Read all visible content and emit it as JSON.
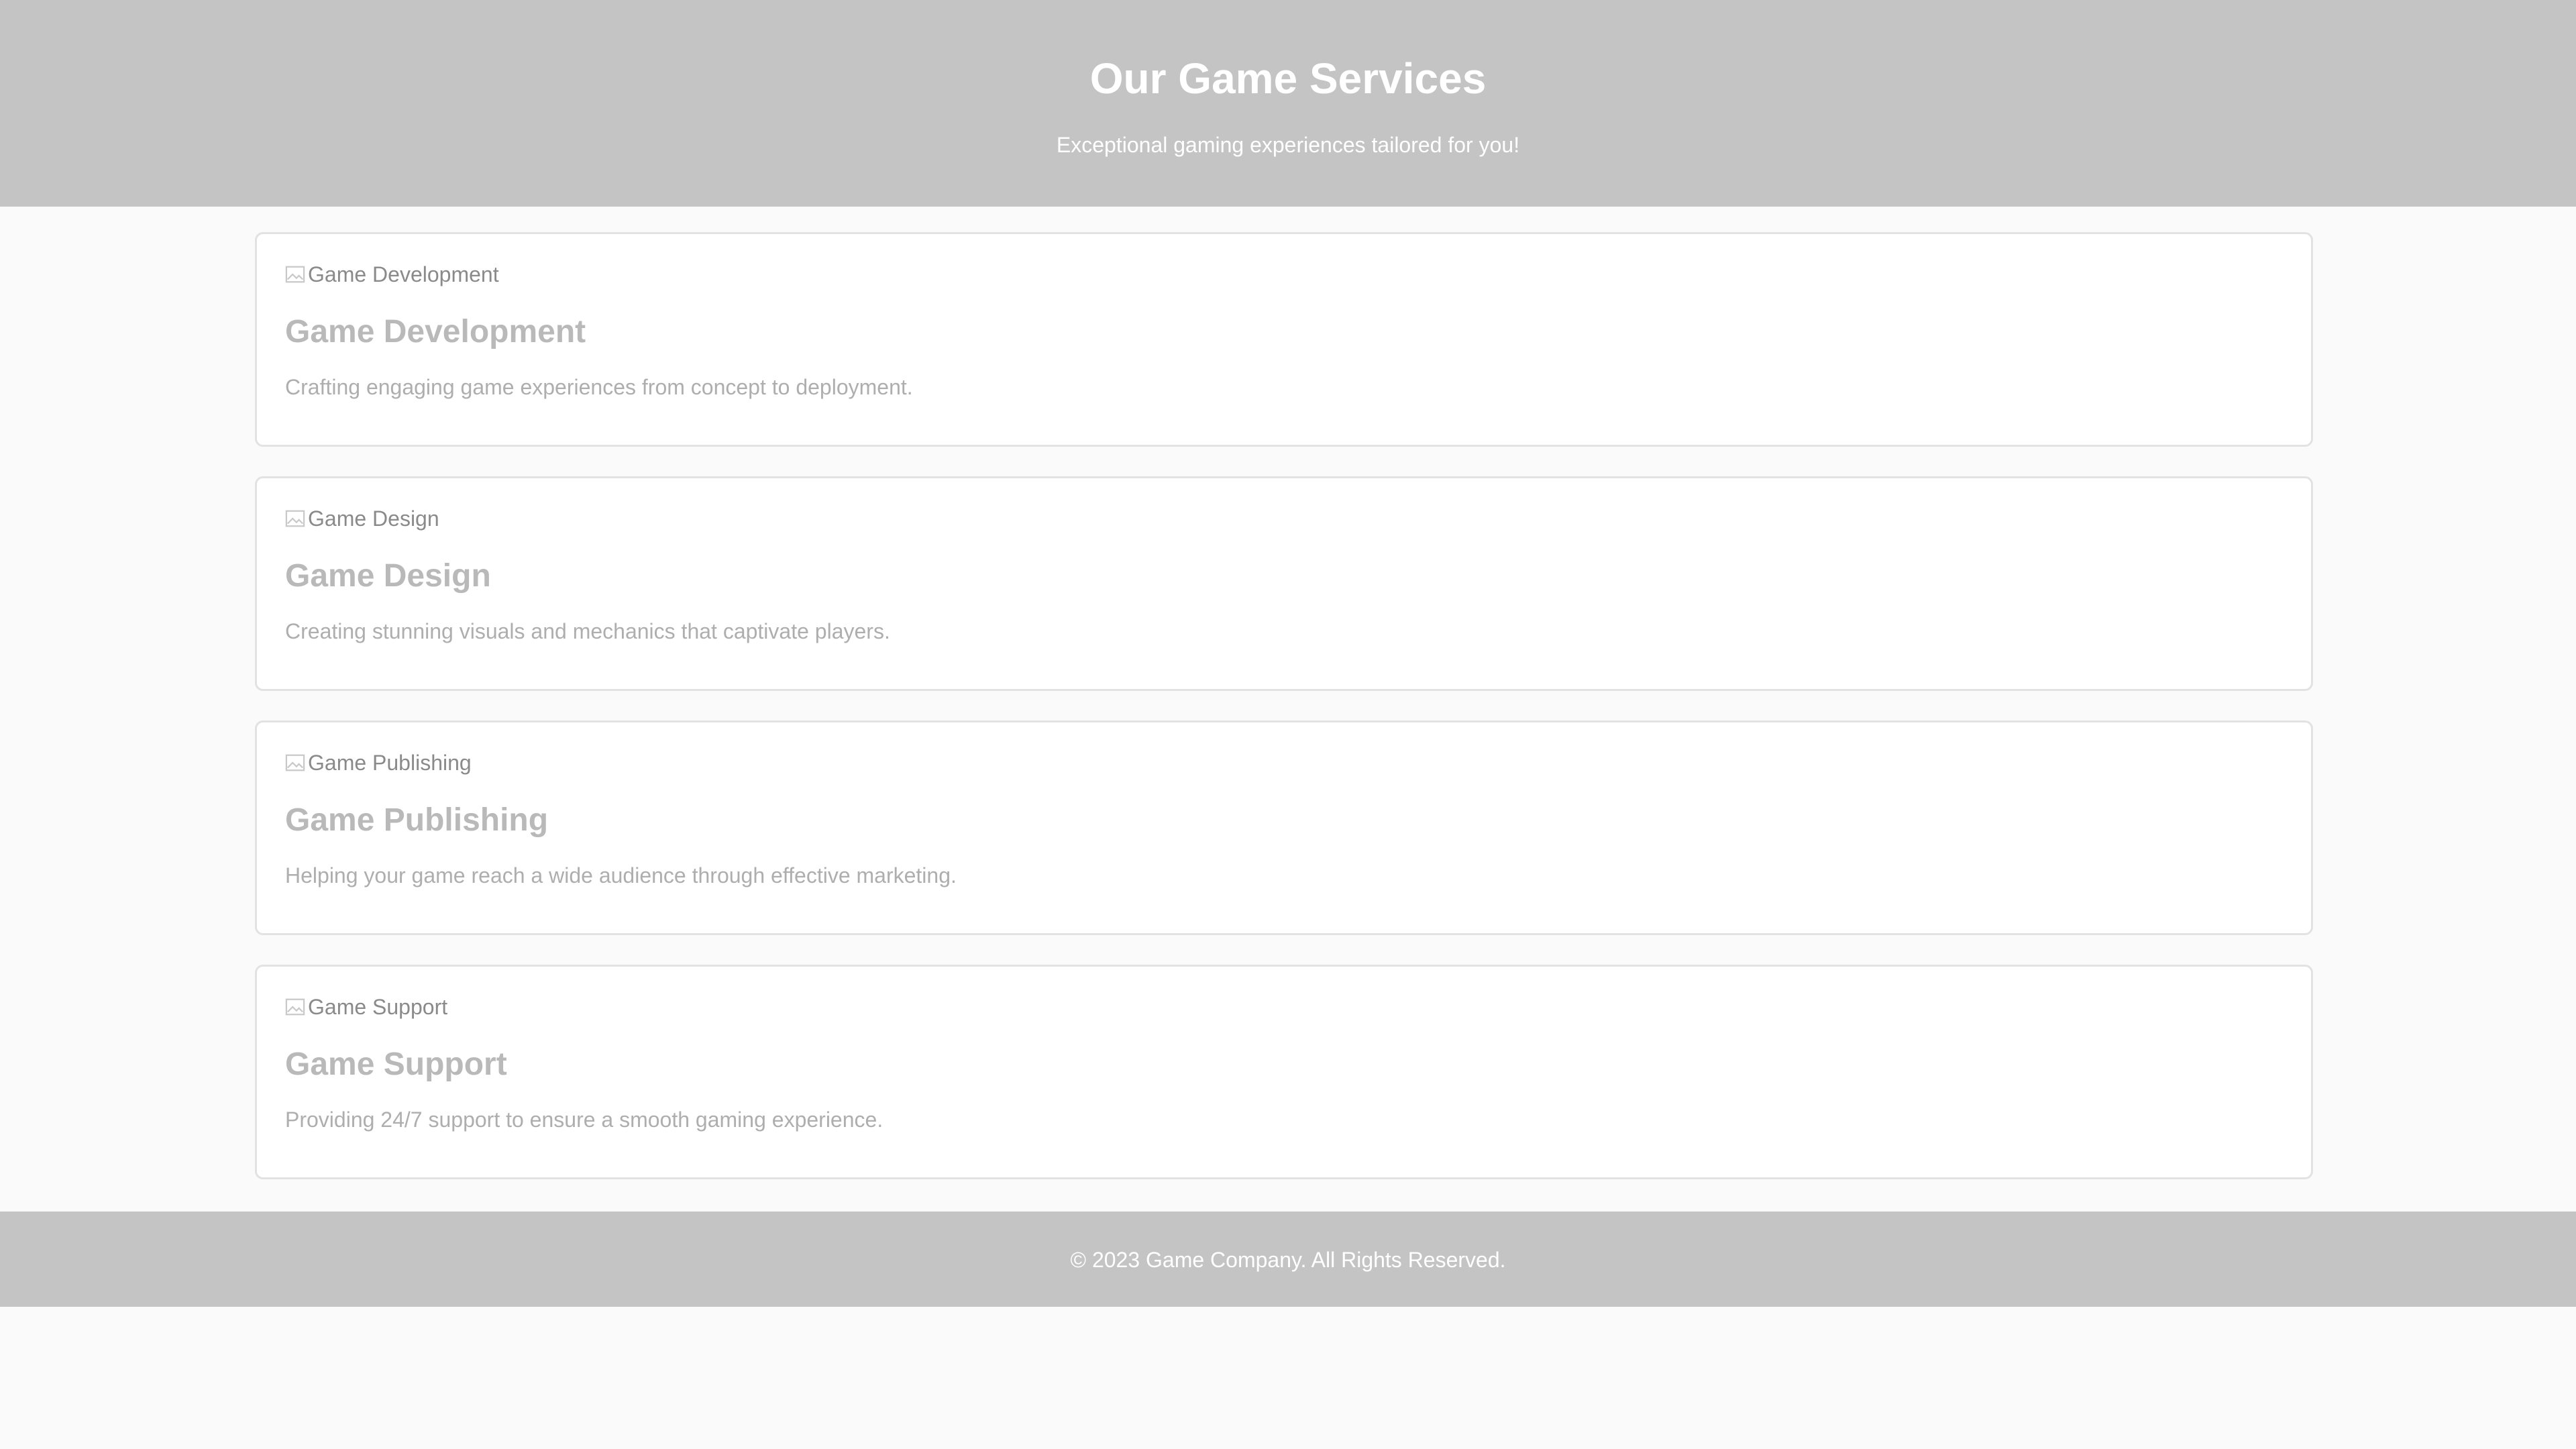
{
  "header": {
    "title": "Our Game Services",
    "subtitle": "Exceptional gaming experiences tailored for you!"
  },
  "services": [
    {
      "image_alt": "Game Development",
      "title": "Game Development",
      "description": "Crafting engaging game experiences from concept to deployment."
    },
    {
      "image_alt": "Game Design",
      "title": "Game Design",
      "description": "Creating stunning visuals and mechanics that captivate players."
    },
    {
      "image_alt": "Game Publishing",
      "title": "Game Publishing",
      "description": "Helping your game reach a wide audience through effective marketing."
    },
    {
      "image_alt": "Game Support",
      "title": "Game Support",
      "description": "Providing 24/7 support to ensure a smooth gaming experience."
    }
  ],
  "footer": {
    "copyright": "© 2023 Game Company. All Rights Reserved."
  },
  "colors": {
    "header_bg": "#c4c4c4",
    "page_bg": "#fafafa",
    "card_bg": "#ffffff",
    "card_border": "#e2e2e2"
  },
  "icons": {
    "image_placeholder": "broken-image-icon"
  }
}
